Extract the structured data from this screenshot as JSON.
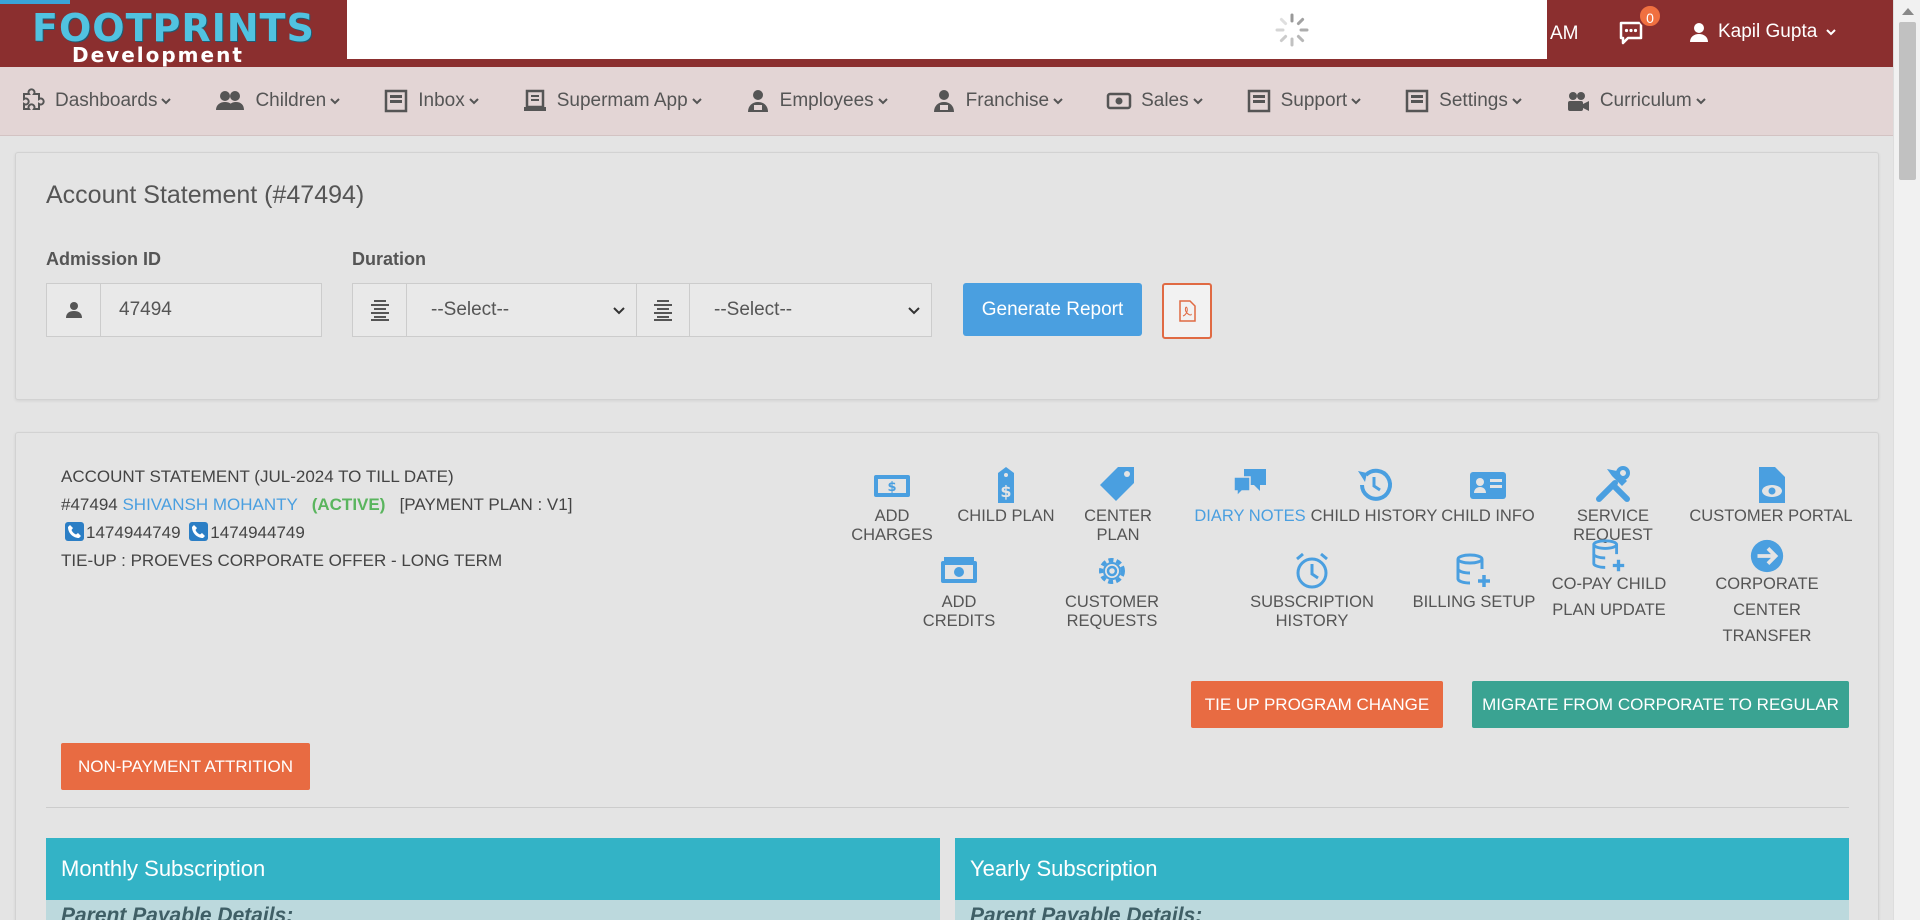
{
  "header": {
    "brand": "FOOTPRINTS",
    "brand_sub": "Development",
    "right_text": "AM",
    "chat_count": "0",
    "user_name": "Kapil Gupta"
  },
  "nav": {
    "items": [
      {
        "label": "Dashboards",
        "icon": "puzzle-icon"
      },
      {
        "label": "Children",
        "icon": "users-icon"
      },
      {
        "label": "Inbox",
        "icon": "inbox-icon"
      },
      {
        "label": "Supermam App",
        "icon": "app-icon"
      },
      {
        "label": "Employees",
        "icon": "employee-icon"
      },
      {
        "label": "Franchise",
        "icon": "franchise-icon"
      },
      {
        "label": "Sales",
        "icon": "money-icon"
      },
      {
        "label": "Support",
        "icon": "support-icon"
      },
      {
        "label": "Settings",
        "icon": "settings-icon"
      },
      {
        "label": "Curriculum",
        "icon": "curriculum-icon"
      }
    ]
  },
  "report": {
    "title": "Account Statement (#47494)",
    "admission_label": "Admission ID",
    "admission_value": "47494",
    "duration_label": "Duration",
    "select1": "--Select--",
    "select2": "--Select--",
    "generate_label": "Generate Report"
  },
  "account": {
    "period": "ACCOUNT STATEMENT (JUL-2024 TO TILL DATE)",
    "id": "#47494",
    "name": "SHIVANSH MOHANTY",
    "status": "(ACTIVE)",
    "plan": "[PAYMENT PLAN : V1]",
    "phone1": "1474944749",
    "phone2": "1474944749",
    "tieup": "TIE-UP : PROEVES CORPORATE OFFER - LONG TERM"
  },
  "actions_row1": [
    "ADD CHARGES",
    "CHILD PLAN",
    "CENTER PLAN",
    "DIARY NOTES",
    "CHILD HISTORY",
    "CHILD INFO",
    "SERVICE REQUEST",
    "CUSTOMER PORTAL"
  ],
  "actions_row2": [
    "ADD CREDITS",
    "CUSTOMER REQUESTS",
    "SUBSCRIPTION HISTORY",
    "BILLING SETUP",
    "CO-PAY CHILD",
    "PLAN UPDATE",
    "CORPORATE CENTER",
    "TRANSFER"
  ],
  "buttons": {
    "tieup_change": "TIE UP PROGRAM CHANGE",
    "migrate": "MIGRATE FROM CORPORATE TO REGULAR",
    "attrition": "NON-PAYMENT ATTRITION"
  },
  "sections": {
    "monthly": "Monthly Subscription",
    "yearly": "Yearly Subscription",
    "parent_payable": "Parent Payable Details:"
  },
  "colors": {
    "topbar": "#8b2f2f",
    "nav": "#e3d5d5",
    "primary": "#4a9fe0",
    "orange": "#e86b42",
    "teal": "#3aa392",
    "section": "#33b3c6"
  }
}
